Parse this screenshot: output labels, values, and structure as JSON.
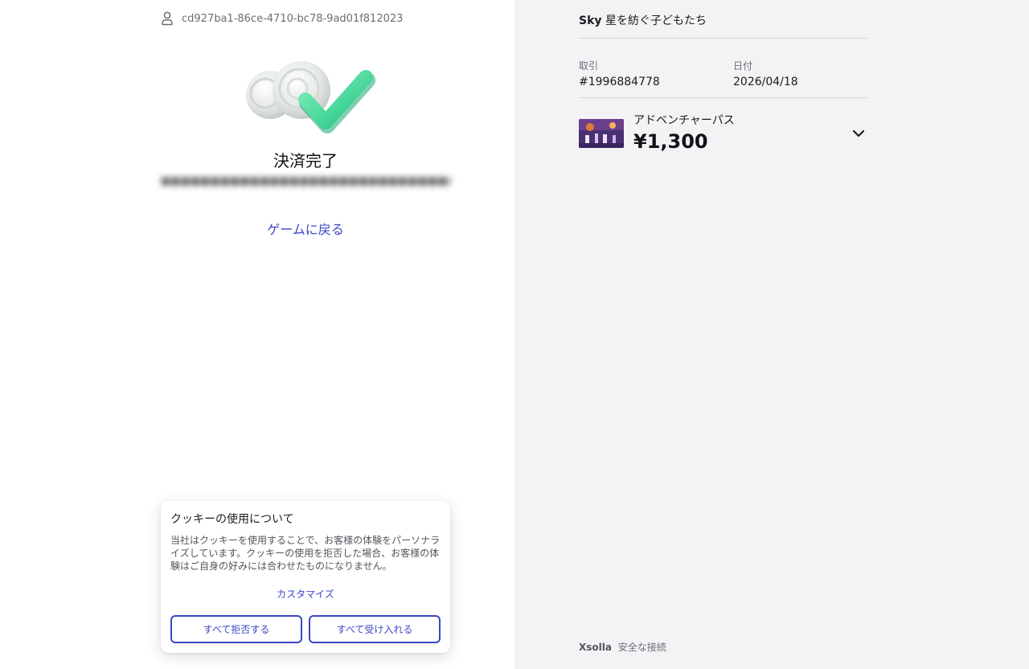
{
  "user": {
    "id": "cd927ba1-86ce-4710-bc78-9ad01f812023",
    "icon": "user-icon"
  },
  "status": {
    "title": "決済完了",
    "blurred_text": "",
    "back_link": "ゲームに戻る",
    "illustration": "success-check-icon",
    "accent_color": "#3ed397"
  },
  "cookie": {
    "title": "クッキーの使用について",
    "body": "当社はクッキーを使用することで、お客様の体験をパーソナライズしています。クッキーの使用を拒否した場合、お客様の体験はご自身の好みには合わせたものになりません。",
    "customize": "カスタマイズ",
    "reject_all": "すべて拒否する",
    "accept_all": "すべて受け入れる",
    "button_color": "#3a47c5"
  },
  "order": {
    "game_brand": "Sky",
    "game_title": "星を紡ぐ子どもたち",
    "transaction_label": "取引",
    "transaction_value": "#1996884778",
    "date_label": "日付",
    "date_value": "2026/04/18",
    "item_name": "アドベンチャーパス",
    "item_price": "¥1,300",
    "expand_icon": "chevron-down-icon"
  },
  "footer": {
    "brand": "Xsolla",
    "text": "安全な接続"
  }
}
